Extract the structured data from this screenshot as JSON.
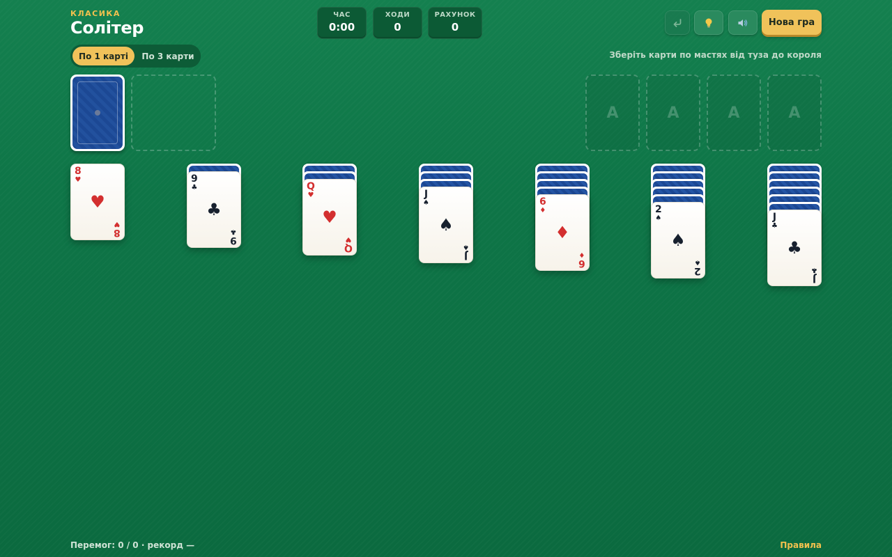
{
  "brand": {
    "subtitle": "КЛАСИКА",
    "title": "Солітер"
  },
  "stats": [
    {
      "label": "ЧАС",
      "value": "0:00"
    },
    {
      "label": "ХОДИ",
      "value": "0"
    },
    {
      "label": "РАХУНОК",
      "value": "0"
    }
  ],
  "toolbar": {
    "new_game_label": "Нова гра",
    "undo_icon": "undo-icon",
    "hint_icon": "lightbulb-icon",
    "sound_icon": "speaker-icon"
  },
  "mode": {
    "option1": "По 1 карті",
    "option3": "По 3 карти",
    "selected": "По 1 карті"
  },
  "hint_text": "Зберіть карти по мастях від туза до короля",
  "foundations": [
    "A",
    "A",
    "A",
    "A"
  ],
  "tableau": [
    {
      "hidden": 0,
      "rank": "8",
      "suit": "♥",
      "color": "red"
    },
    {
      "hidden": 1,
      "rank": "9",
      "suit": "♣",
      "color": "black"
    },
    {
      "hidden": 2,
      "rank": "Q",
      "suit": "♥",
      "color": "red"
    },
    {
      "hidden": 3,
      "rank": "J",
      "suit": "♠",
      "color": "black"
    },
    {
      "hidden": 4,
      "rank": "6",
      "suit": "♦",
      "color": "red"
    },
    {
      "hidden": 5,
      "rank": "2",
      "suit": "♠",
      "color": "black"
    },
    {
      "hidden": 6,
      "rank": "J",
      "suit": "♣",
      "color": "black"
    }
  ],
  "footer": {
    "redeal_text": "Перемог: 0 / 0 · рекорд —",
    "rules_label": "Правила"
  },
  "colors": {
    "felt": "#0e7547",
    "accent": "#f0c25a",
    "red_suit": "#d32f2f",
    "black_suit": "#17202e",
    "card_back": "#1d4a9b"
  }
}
